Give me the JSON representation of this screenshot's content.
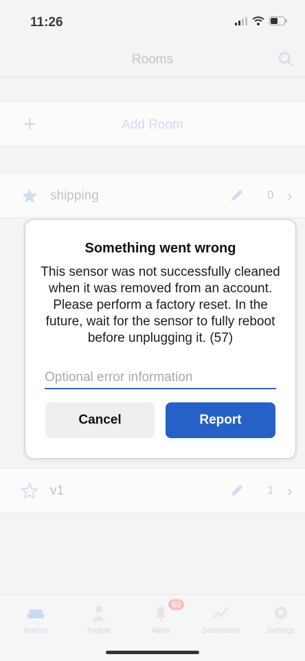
{
  "status_bar": {
    "time": "11:26"
  },
  "nav": {
    "title": "Rooms",
    "search_icon": "search-icon"
  },
  "add_room": {
    "icon": "plus-icon",
    "label": "Add Room"
  },
  "rooms": [
    {
      "name": "shipping",
      "count": "0",
      "favorite": true
    },
    {
      "name": "v1",
      "count": "1",
      "favorite": false
    }
  ],
  "dialog": {
    "title": "Something went wrong",
    "message": "This sensor was not successfully cleaned when it was removed from an account. Please perform a factory reset. In the future, wait for the sensor to fully reboot before unplugging it. (57)",
    "input_placeholder": "Optional error information",
    "cancel_label": "Cancel",
    "report_label": "Report"
  },
  "tabs": [
    {
      "label": "Rooms",
      "icon": "bed-icon",
      "active": true
    },
    {
      "label": "People",
      "icon": "person-icon",
      "active": false
    },
    {
      "label": "Alerts",
      "icon": "bell-icon",
      "active": false,
      "badge": "60"
    },
    {
      "label": "Dashboard",
      "icon": "chart-icon",
      "active": false
    },
    {
      "label": "Settings",
      "icon": "gear-icon",
      "active": false
    }
  ],
  "colors": {
    "accent": "#2661c7",
    "badge": "#f3b8b3"
  }
}
